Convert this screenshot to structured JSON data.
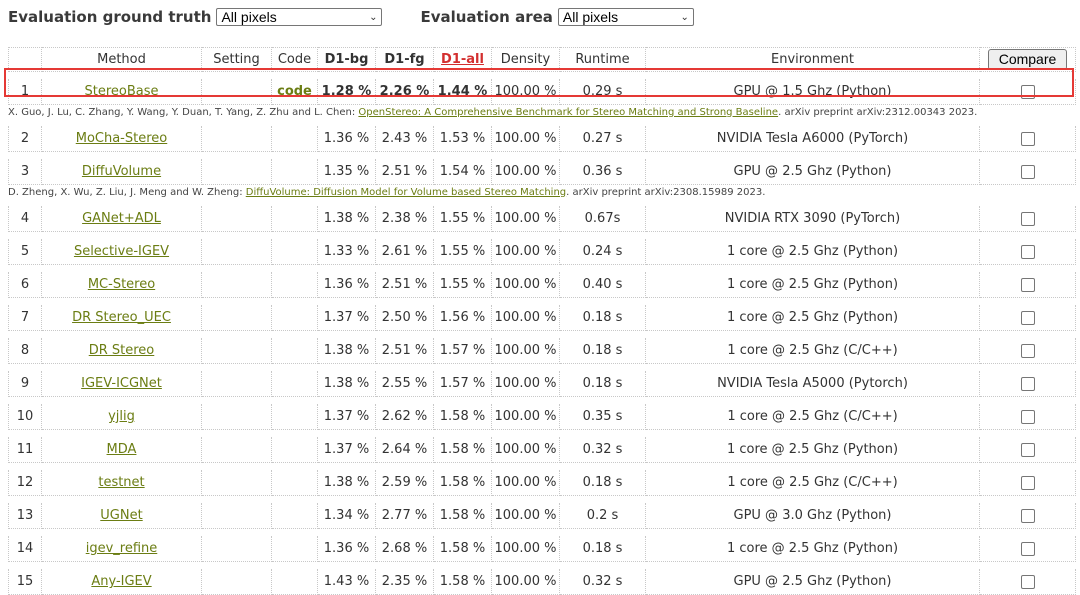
{
  "filters": {
    "ground_truth_label": "Evaluation ground truth",
    "ground_truth_value": "All pixels",
    "area_label": "Evaluation area",
    "area_value": "All pixels"
  },
  "table": {
    "headers": [
      "",
      "Method",
      "Setting",
      "Code",
      "D1-bg",
      "D1-fg",
      "D1-all",
      "Density",
      "Runtime",
      "Environment",
      "Compare"
    ],
    "rows": [
      {
        "rank": "1",
        "method": "StereoBase",
        "setting": "",
        "code": "code",
        "d1_bg": "1.28 %",
        "d1_fg": "2.26 %",
        "d1_all": "1.44 %",
        "density": "100.00 %",
        "runtime": "0.29 s",
        "env": "GPU @ 1.5 Ghz (Python)",
        "cite_prefix": "X. Guo, J. Lu, C. Zhang, Y. Wang, Y. Duan, T. Yang, Z. Zhu and L. Chen: ",
        "cite_title": "OpenStereo: A Comprehensive Benchmark for Stereo Matching and Strong Baseline",
        "cite_suffix": ". arXiv preprint arXiv:2312.00343 2023."
      },
      {
        "rank": "2",
        "method": "MoCha-Stereo",
        "setting": "",
        "code": "",
        "d1_bg": "1.36 %",
        "d1_fg": "2.43 %",
        "d1_all": "1.53 %",
        "density": "100.00 %",
        "runtime": "0.27 s",
        "env": "NVIDIA Tesla A6000 (PyTorch)"
      },
      {
        "rank": "3",
        "method": "DiffuVolume",
        "setting": "",
        "code": "",
        "d1_bg": "1.35 %",
        "d1_fg": "2.51 %",
        "d1_all": "1.54 %",
        "density": "100.00 %",
        "runtime": "0.36 s",
        "env": "GPU @ 2.5 Ghz (Python)",
        "cite_prefix": "D. Zheng, X. Wu, Z. Liu, J. Meng and W. Zheng: ",
        "cite_title": "DiffuVolume: Diffusion Model for Volume based Stereo Matching",
        "cite_suffix": ". arXiv preprint arXiv:2308.15989 2023."
      },
      {
        "rank": "4",
        "method": "GANet+ADL",
        "setting": "",
        "code": "",
        "d1_bg": "1.38 %",
        "d1_fg": "2.38 %",
        "d1_all": "1.55 %",
        "density": "100.00 %",
        "runtime": "0.67s",
        "env": "NVIDIA RTX 3090 (PyTorch)"
      },
      {
        "rank": "5",
        "method": "Selective-IGEV",
        "setting": "",
        "code": "",
        "d1_bg": "1.33 %",
        "d1_fg": "2.61 %",
        "d1_all": "1.55 %",
        "density": "100.00 %",
        "runtime": "0.24 s",
        "env": "1 core @ 2.5 Ghz (Python)"
      },
      {
        "rank": "6",
        "method": "MC-Stereo",
        "setting": "",
        "code": "",
        "d1_bg": "1.36 %",
        "d1_fg": "2.51 %",
        "d1_all": "1.55 %",
        "density": "100.00 %",
        "runtime": "0.40 s",
        "env": "1 core @ 2.5 Ghz (Python)"
      },
      {
        "rank": "7",
        "method": "DR Stereo_UEC",
        "setting": "",
        "code": "",
        "d1_bg": "1.37 %",
        "d1_fg": "2.50 %",
        "d1_all": "1.56 %",
        "density": "100.00 %",
        "runtime": "0.18 s",
        "env": "1 core @ 2.5 Ghz (Python)"
      },
      {
        "rank": "8",
        "method": "DR Stereo",
        "setting": "",
        "code": "",
        "d1_bg": "1.38 %",
        "d1_fg": "2.51 %",
        "d1_all": "1.57 %",
        "density": "100.00 %",
        "runtime": "0.18 s",
        "env": "1 core @ 2.5 Ghz (C/C++)"
      },
      {
        "rank": "9",
        "method": "IGEV-ICGNet",
        "setting": "",
        "code": "",
        "d1_bg": "1.38 %",
        "d1_fg": "2.55 %",
        "d1_all": "1.57 %",
        "density": "100.00 %",
        "runtime": "0.18 s",
        "env": "NVIDIA Tesla A5000 (Pytorch)"
      },
      {
        "rank": "10",
        "method": "yjlig",
        "setting": "",
        "code": "",
        "d1_bg": "1.37 %",
        "d1_fg": "2.62 %",
        "d1_all": "1.58 %",
        "density": "100.00 %",
        "runtime": "0.35 s",
        "env": "1 core @ 2.5 Ghz (C/C++)"
      },
      {
        "rank": "11",
        "method": "MDA",
        "setting": "",
        "code": "",
        "d1_bg": "1.37 %",
        "d1_fg": "2.64 %",
        "d1_all": "1.58 %",
        "density": "100.00 %",
        "runtime": "0.32 s",
        "env": "1 core @ 2.5 Ghz (Python)"
      },
      {
        "rank": "12",
        "method": "testnet",
        "setting": "",
        "code": "",
        "d1_bg": "1.38 %",
        "d1_fg": "2.59 %",
        "d1_all": "1.58 %",
        "density": "100.00 %",
        "runtime": "0.18 s",
        "env": "1 core @ 2.5 Ghz (C/C++)"
      },
      {
        "rank": "13",
        "method": "UGNet",
        "setting": "",
        "code": "",
        "d1_bg": "1.34 %",
        "d1_fg": "2.77 %",
        "d1_all": "1.58 %",
        "density": "100.00 %",
        "runtime": "0.2 s",
        "env": "GPU @ 3.0 Ghz (Python)"
      },
      {
        "rank": "14",
        "method": "igev_refine",
        "setting": "",
        "code": "",
        "d1_bg": "1.36 %",
        "d1_fg": "2.68 %",
        "d1_all": "1.58 %",
        "density": "100.00 %",
        "runtime": "0.18 s",
        "env": "1 core @ 2.5 Ghz (Python)"
      },
      {
        "rank": "15",
        "method": "Any-IGEV",
        "setting": "",
        "code": "",
        "d1_bg": "1.43 %",
        "d1_fg": "2.35 %",
        "d1_all": "1.58 %",
        "density": "100.00 %",
        "runtime": "0.32 s",
        "env": "GPU @ 2.5 Ghz (Python)"
      }
    ]
  },
  "colors": {
    "link": "#6b7d13",
    "sorted_header": "#d32f2f",
    "highlight_border": "#e53935"
  }
}
